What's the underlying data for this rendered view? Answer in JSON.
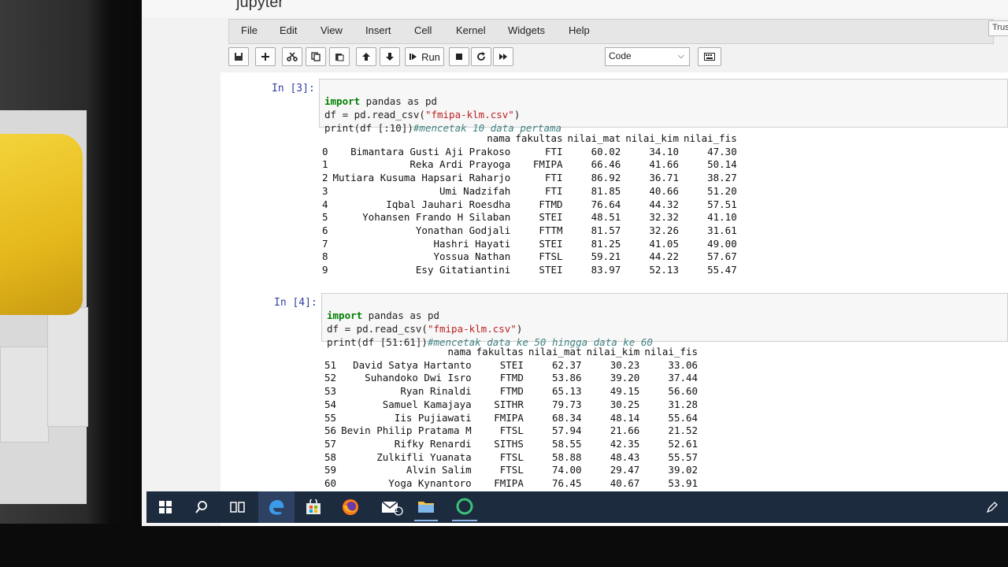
{
  "app": {
    "title": "jupyter"
  },
  "menu": [
    "File",
    "Edit",
    "View",
    "Insert",
    "Cell",
    "Kernel",
    "Widgets",
    "Help"
  ],
  "trusted": "Trus",
  "toolbar": {
    "run_label": "Run",
    "cell_type": "Code"
  },
  "cell1": {
    "prompt": "In [3]:",
    "code": [
      {
        "kw": "import",
        "rest": " pandas as pd"
      },
      {
        "pre": "df = pd.read_csv(",
        "str": "\"fmipa-klm.csv\"",
        "post": ")"
      },
      {
        "pre": "print(df [:10])",
        "cmt": "#mencetak 10 data pertama"
      }
    ],
    "columns": [
      "",
      "nama",
      "fakultas",
      "nilai_mat",
      "nilai_kim",
      "nilai_fis"
    ],
    "rows": [
      [
        "0",
        "Bimantara Gusti Aji Prakoso",
        "FTI",
        "60.02",
        "34.10",
        "47.30"
      ],
      [
        "1",
        "Reka Ardi Prayoga",
        "FMIPA",
        "66.46",
        "41.66",
        "50.14"
      ],
      [
        "2",
        "Mutiara Kusuma Hapsari Raharjo",
        "FTI",
        "86.92",
        "36.71",
        "38.27"
      ],
      [
        "3",
        "Umi Nadzifah",
        "FTI",
        "81.85",
        "40.66",
        "51.20"
      ],
      [
        "4",
        "Iqbal Jauhari Roesdha",
        "FTMD",
        "76.64",
        "44.32",
        "57.51"
      ],
      [
        "5",
        "Yohansen Frando H Silaban",
        "STEI",
        "48.51",
        "32.32",
        "41.10"
      ],
      [
        "6",
        "Yonathan Godjali",
        "FTTM",
        "81.57",
        "32.26",
        "31.61"
      ],
      [
        "7",
        "Hashri Hayati",
        "STEI",
        "81.25",
        "41.05",
        "49.00"
      ],
      [
        "8",
        "Yossua Nathan",
        "FTSL",
        "59.21",
        "44.22",
        "57.67"
      ],
      [
        "9",
        "Esy Gitatiantini",
        "STEI",
        "83.97",
        "52.13",
        "55.47"
      ]
    ]
  },
  "cell2": {
    "prompt": "In [4]:",
    "code": [
      {
        "kw": "import",
        "rest": " pandas as pd"
      },
      {
        "pre": "df = pd.read_csv(",
        "str": "\"fmipa-klm.csv\"",
        "post": ")"
      },
      {
        "pre": "print(df [51:61])",
        "cmt": "#mencetak data ke 50 hingga data ke 60"
      }
    ],
    "columns": [
      "",
      "nama",
      "fakultas",
      "nilai_mat",
      "nilai_kim",
      "nilai_fis"
    ],
    "rows": [
      [
        "51",
        "David Satya Hartanto",
        "STEI",
        "62.37",
        "30.23",
        "33.06"
      ],
      [
        "52",
        "Suhandoko Dwi Isro",
        "FTMD",
        "53.86",
        "39.20",
        "37.44"
      ],
      [
        "53",
        "Ryan Rinaldi",
        "FTMD",
        "65.13",
        "49.15",
        "56.60"
      ],
      [
        "54",
        "Samuel Kamajaya",
        "SITHR",
        "79.73",
        "30.25",
        "31.28"
      ],
      [
        "55",
        "Iis Pujiawati",
        "FMIPA",
        "68.34",
        "48.14",
        "55.64"
      ],
      [
        "56",
        "Bevin Philip Pratama M",
        "FTSL",
        "57.94",
        "21.66",
        "21.52"
      ],
      [
        "57",
        "Rifky Renardi",
        "SITHS",
        "58.55",
        "42.35",
        "52.61"
      ],
      [
        "58",
        "Zulkifli Yuanata",
        "FTSL",
        "58.88",
        "48.43",
        "55.57"
      ],
      [
        "59",
        "Alvin Salim",
        "FTSL",
        "74.00",
        "29.47",
        "39.02"
      ],
      [
        "60",
        "Yoga Kynantoro",
        "FMIPA",
        "76.45",
        "40.67",
        "53.91"
      ]
    ]
  },
  "taskbar": {
    "icons": [
      "windows-icon",
      "search-icon",
      "task-view-icon",
      "edge-icon",
      "store-icon",
      "firefox-icon",
      "mail-icon",
      "file-explorer-icon",
      "app-circle-icon"
    ],
    "mail_badge": "1",
    "colors": {
      "bg": "#1c2b3e",
      "edge": "#3c9be8",
      "firefox": "#ff7a1a",
      "store": "#3c9be8",
      "green": "#3cc07a"
    }
  }
}
